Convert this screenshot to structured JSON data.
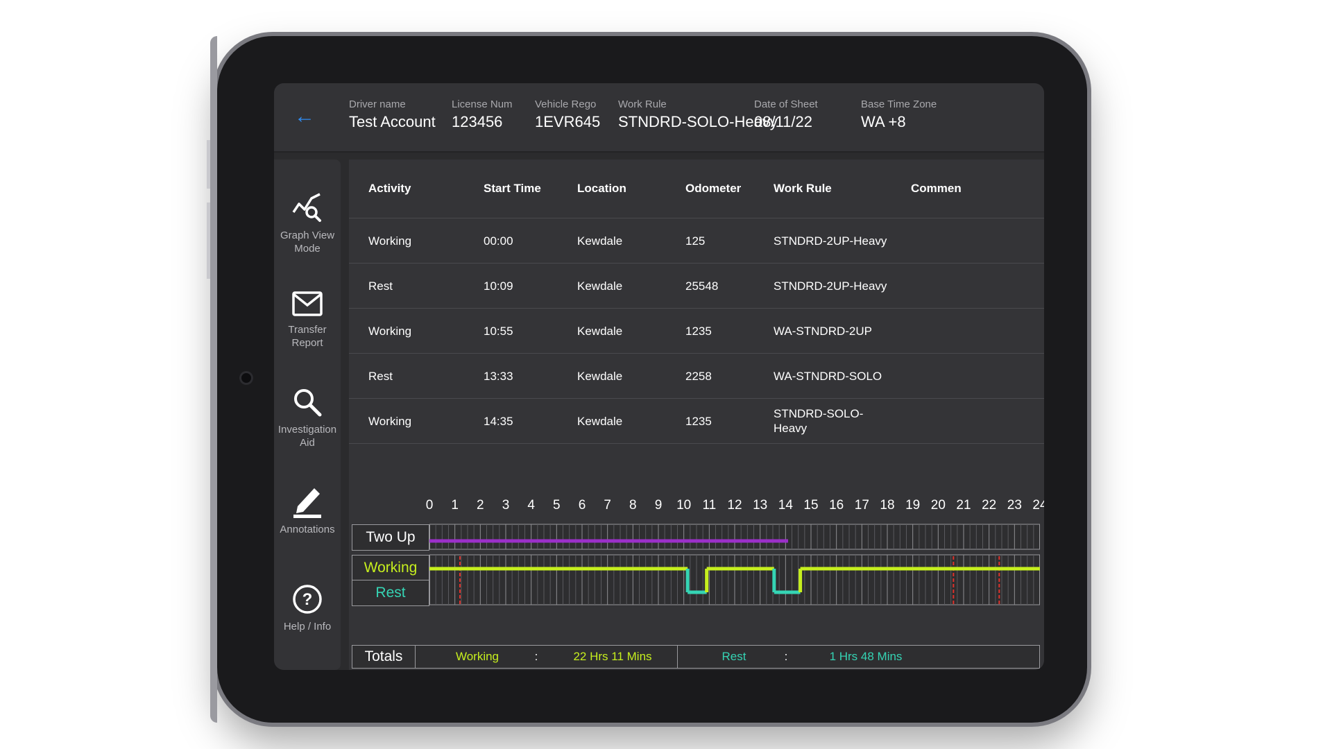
{
  "header": {
    "back_icon": "arrow-left-icon",
    "fields": [
      {
        "label": "Driver name",
        "value": "Test Account"
      },
      {
        "label": "License Num",
        "value": "123456"
      },
      {
        "label": "Vehicle Rego",
        "value": "1EVR645"
      },
      {
        "label": "Work Rule",
        "value": "STNDRD-SOLO-Heavy"
      },
      {
        "label": "Date of Sheet",
        "value": "08/11/22"
      },
      {
        "label": "Base Time Zone",
        "value": "WA +8"
      }
    ]
  },
  "sidebar": {
    "items": [
      {
        "label": "Graph View Mode",
        "icon": "graph-search-icon"
      },
      {
        "label": "Transfer Report",
        "icon": "envelope-icon"
      },
      {
        "label": "Investigation Aid",
        "icon": "search-icon"
      },
      {
        "label": "Annotations",
        "icon": "pencil-icon"
      },
      {
        "label": "Help / Info",
        "icon": "help-circle-icon"
      }
    ]
  },
  "table": {
    "columns": [
      "Activity",
      "Start Time",
      "Location",
      "Odometer",
      "Work Rule",
      "Commen"
    ],
    "rows": [
      {
        "activity": "Working",
        "start": "00:00",
        "location": "Kewdale",
        "odometer": "125",
        "work_rule": "STNDRD-2UP-Heavy",
        "comment": ""
      },
      {
        "activity": "Rest",
        "start": "10:09",
        "location": "Kewdale",
        "odometer": "25548",
        "work_rule": "STNDRD-2UP-Heavy",
        "comment": ""
      },
      {
        "activity": "Working",
        "start": "10:55",
        "location": "Kewdale",
        "odometer": "1235",
        "work_rule": "WA-STNDRD-2UP",
        "comment": ""
      },
      {
        "activity": "Rest",
        "start": "13:33",
        "location": "Kewdale",
        "odometer": "2258",
        "work_rule": "WA-STNDRD-SOLO",
        "comment": ""
      },
      {
        "activity": "Working",
        "start": "14:35",
        "location": "Kewdale",
        "odometer": "1235",
        "work_rule": "STNDRD-SOLO-Heavy",
        "comment": ""
      }
    ]
  },
  "graph": {
    "hours": [
      "0",
      "1",
      "2",
      "3",
      "4",
      "5",
      "6",
      "7",
      "8",
      "9",
      "10",
      "11",
      "12",
      "13",
      "14",
      "15",
      "16",
      "17",
      "18",
      "19",
      "20",
      "21",
      "22",
      "23",
      "24"
    ],
    "rows": {
      "two_up": "Two Up",
      "working": "Working",
      "rest": "Rest"
    },
    "two_up_span_hours": [
      0,
      14.1
    ],
    "working_segments_hours": [
      [
        0,
        10.15
      ],
      [
        10.9,
        13.55
      ],
      [
        14.58,
        24
      ]
    ],
    "rest_segments_hours": [
      [
        10.15,
        10.9
      ],
      [
        13.55,
        14.58
      ]
    ],
    "markers_hours": [
      1.2,
      20.6,
      22.4
    ],
    "colors": {
      "working": "#c6ef1e",
      "rest": "#35d4b4",
      "two_up": "#9b30c9",
      "marker": "#e0322c"
    }
  },
  "totals": {
    "label": "Totals",
    "working_label": "Working",
    "separator": ":",
    "working_value": "22 Hrs 11 Mins",
    "rest_label": "Rest",
    "rest_value": "1 Hrs 48 Mins"
  }
}
